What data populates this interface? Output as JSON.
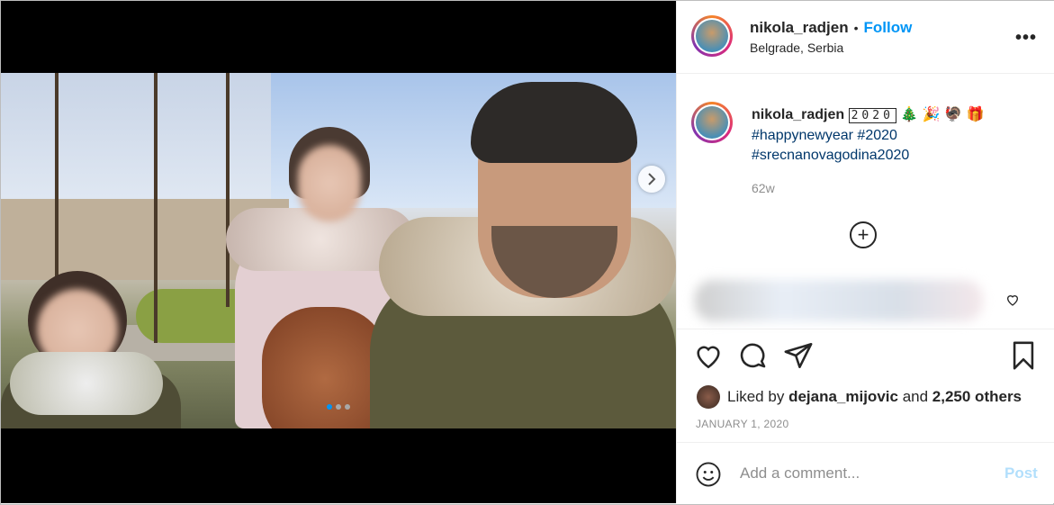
{
  "post": {
    "username": "nikola_radjen",
    "follow_label": "Follow",
    "separator": "•",
    "location": "Belgrade, Serbia",
    "more_label": "•••"
  },
  "caption": {
    "username": "nikola_radjen",
    "emoji": "🄲🄰🄲🄰 🎄🎉🦃🎁",
    "year_box": "2020",
    "emojis": "🎄 🎉 🦃 🎁",
    "hashtag1": "#happynewyear",
    "hashtag2": "#2020",
    "hashtag3": "#srecnanovagodina2020",
    "time": "62w"
  },
  "comments": {
    "load_more": "+"
  },
  "likes": {
    "prefix": "Liked by",
    "liker": "dejana_mijovic",
    "middle": "and",
    "count": "2,250 others"
  },
  "date": "JANUARY 1, 2020",
  "comment_box": {
    "placeholder": "Add a comment...",
    "post_label": "Post"
  },
  "carousel": {
    "slides": 3,
    "active_index": 0
  },
  "colors": {
    "accent": "#0095f6",
    "hashtag": "#00376b",
    "muted": "#8e8e8e"
  }
}
